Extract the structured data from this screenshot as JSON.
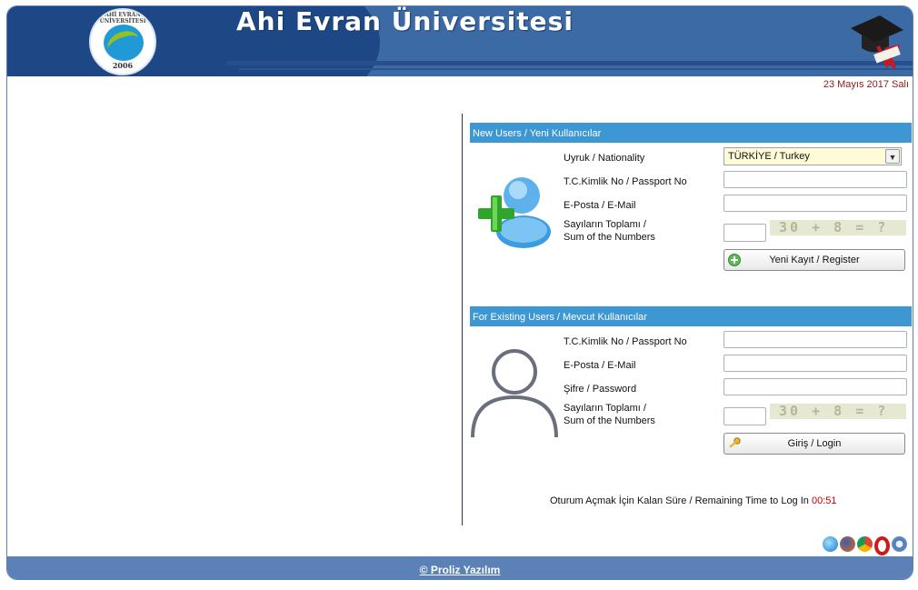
{
  "header": {
    "title": "Ahi Evran Üniversitesi",
    "logo_year": "2006",
    "logo_name": "AHİ EVRAN ÜNİVERSİTESİ"
  },
  "date": "23 Mayıs 2017 Salı",
  "new_users": {
    "heading": "New Users / Yeni Kullanıcılar",
    "nationality_label": "Uyruk / Nationality",
    "nationality_value": "TÜRKİYE / Turkey",
    "id_label": "T.C.Kimlik No / Passport No",
    "email_label": "E-Posta / E-Mail",
    "sum_label_1": "Sayıların Toplamı /",
    "sum_label_2": "Sum of the Numbers",
    "captcha_text": "30 + 8 = ?",
    "register_button": "Yeni Kayıt / Register"
  },
  "existing_users": {
    "heading": "For Existing Users / Mevcut Kullanıcılar",
    "id_label": "T.C.Kimlik No / Passport No",
    "email_label": "E-Posta / E-Mail",
    "password_label": "Şifre / Password",
    "sum_label_1": "Sayıların Toplamı /",
    "sum_label_2": "Sum of the Numbers",
    "captcha_text": "30 + 8 = ?",
    "login_button": "Giriş / Login"
  },
  "timer": {
    "label": "Oturum Açmak İçin Kalan Süre / Remaining Time to Log In",
    "value": "00:51"
  },
  "footer": {
    "link": "© Proliz Yazılım"
  },
  "colors": {
    "header": "#3c6aa5",
    "panel_head": "#3d97d3",
    "footer": "#5b81b6",
    "date": "#8b1a1a",
    "timer": "#cc0000"
  },
  "icons": [
    "add-user-icon",
    "user-silhouette-icon",
    "graduation-cap-icon",
    "plus-circle-icon",
    "key-icon",
    "internet-explorer-icon",
    "firefox-icon",
    "chrome-icon",
    "opera-icon",
    "safari-icon"
  ]
}
